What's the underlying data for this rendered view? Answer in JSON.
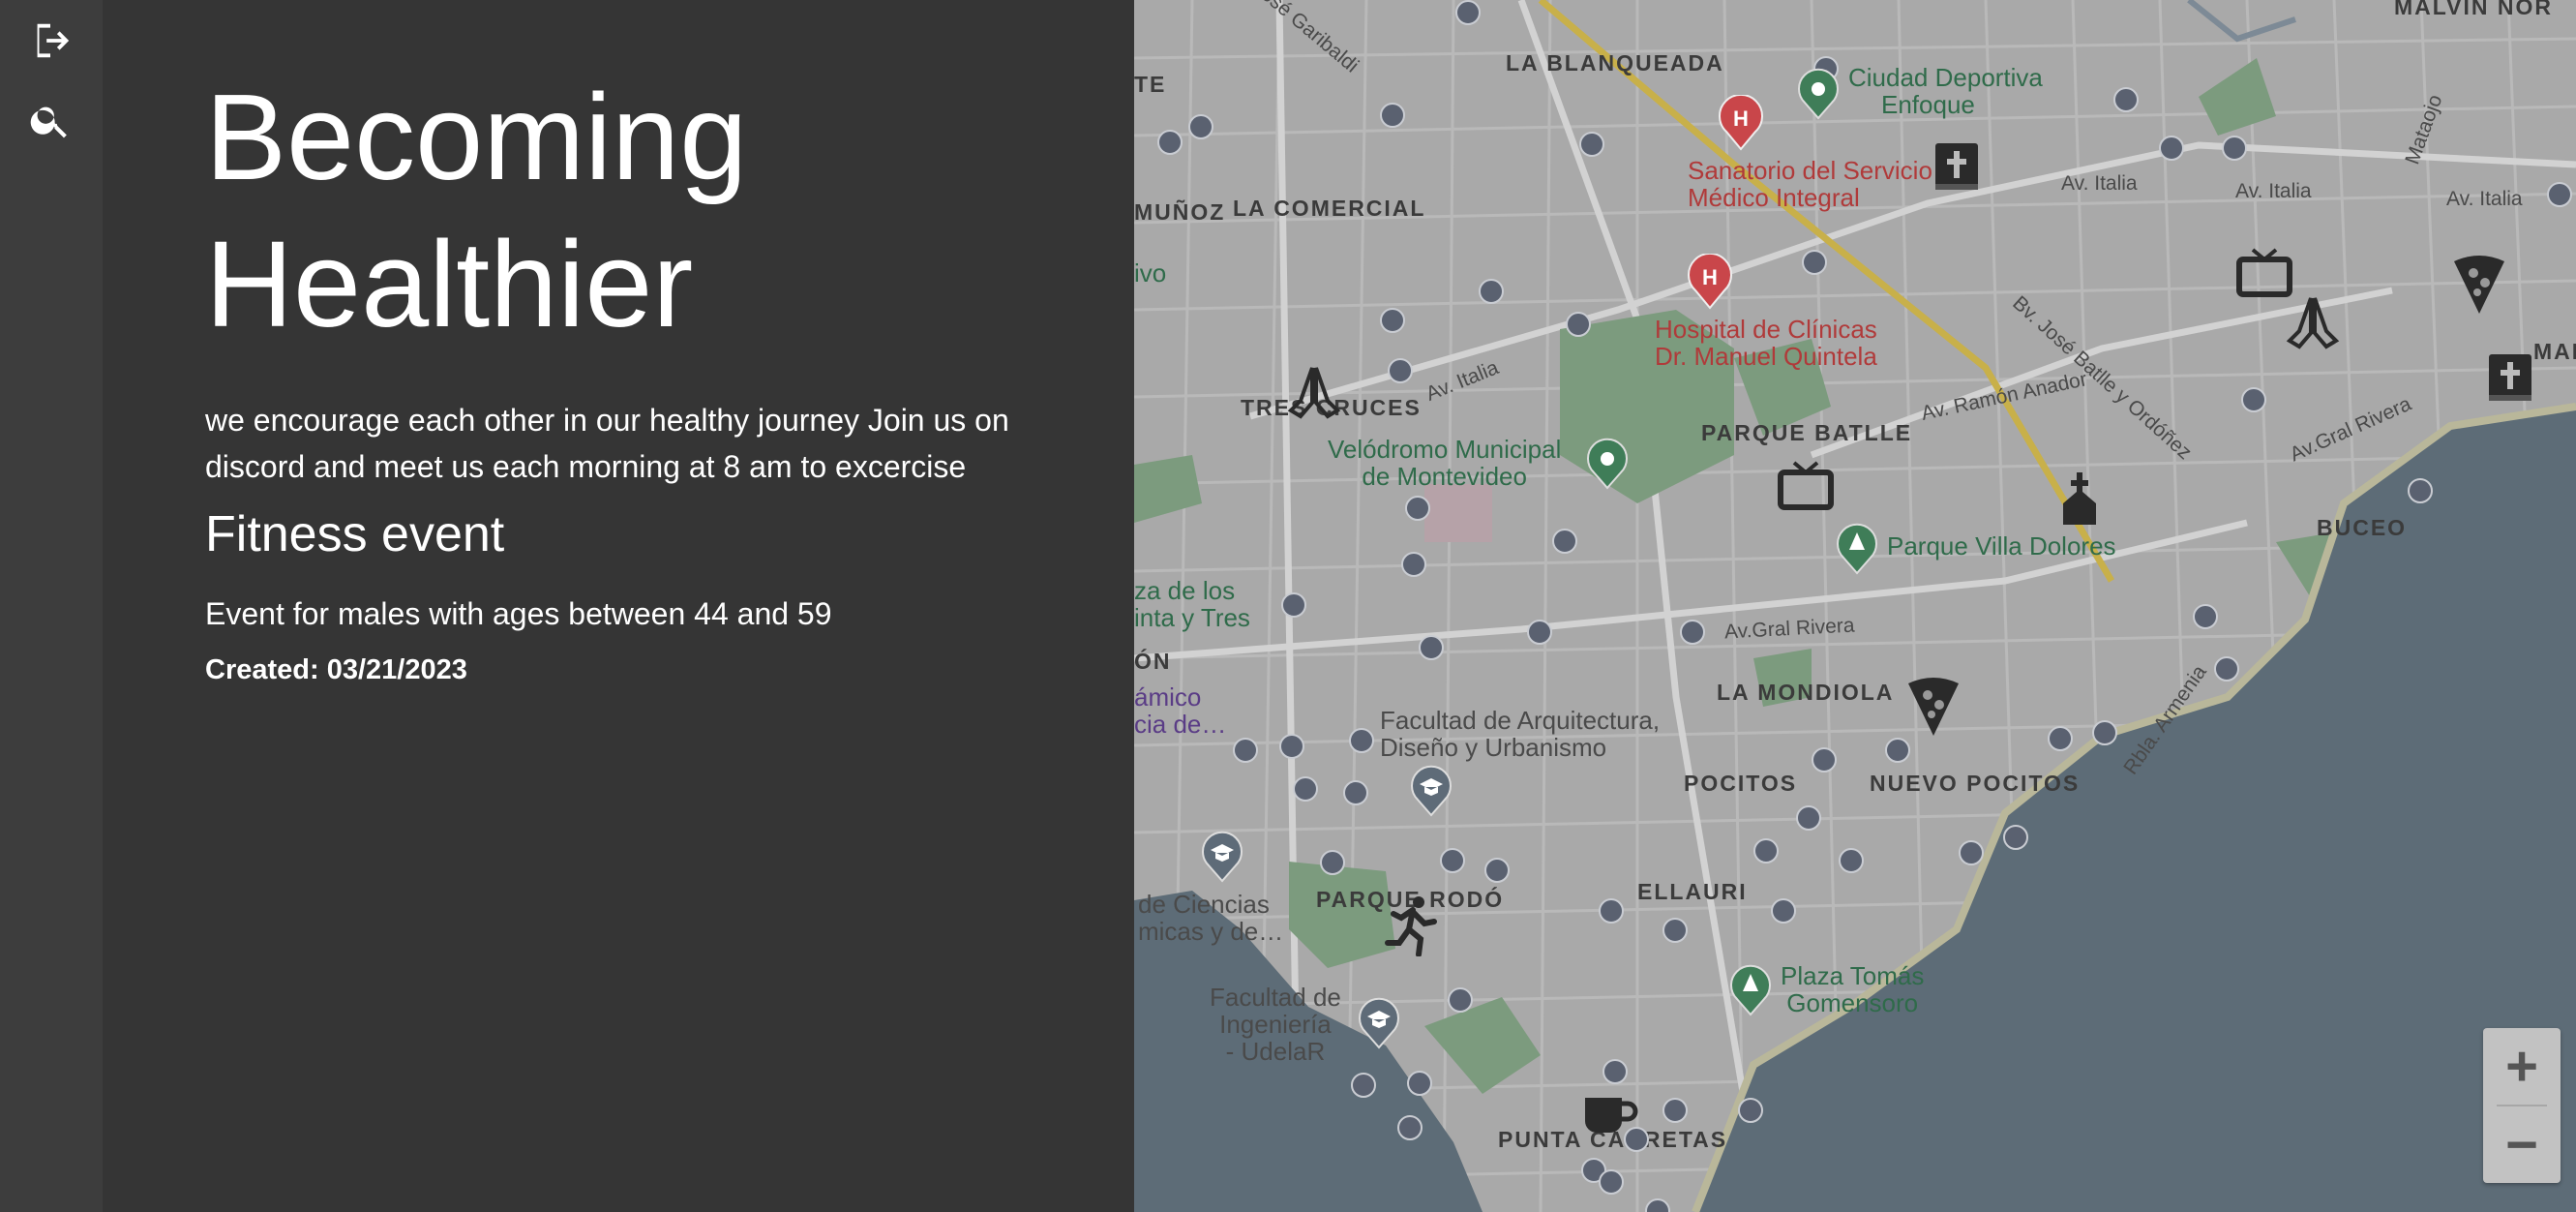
{
  "rail": {
    "logout_icon": "logout-icon",
    "search_icon": "search-icon"
  },
  "panel": {
    "title_line1": "Becoming",
    "title_line2": "Healthier",
    "description": "we encourage each other in our healthy journey Join us on discord and meet us each morning at 8 am to excercise",
    "event_title": "Fitness event",
    "event_description": "Event for males with ages between 44 and 59",
    "created": "Created: 03/21/2023"
  },
  "map": {
    "neighborhoods": {
      "la_blanqueada": "LA BLANQUEADA",
      "la_comercial": "LA COMERCIAL",
      "munoz": "MUÑOZ",
      "tres_cruces": "TRES CRUCES",
      "parque_batlle": "PARQUE BATLLE",
      "buceo": "BUCEO",
      "la_mondiola": "LA MONDIOLA",
      "pocitos": "POCITOS",
      "nuevo_pocitos": "NUEVO POCITOS",
      "parque_rodo": "PARQUE RODÓ",
      "ellauri": "ELLAURI",
      "punta_carretas": "PUNTA CARRETAS",
      "te": "TE",
      "on": "ÓN",
      "mal": "MAL",
      "malvin": "MALVIN NOR"
    },
    "pois": {
      "ciudad_deportiva_1": "Ciudad Deportiva",
      "ciudad_deportiva_2": "Enfoque",
      "sanatorio_1": "Sanatorio del Servicio",
      "sanatorio_2": "Médico Integral",
      "hospital_1": "Hospital de Clínicas",
      "hospital_2": "Dr. Manuel Quintela",
      "velodromo_1": "Velódromo Municipal",
      "velodromo_2": "de Montevideo",
      "villa_dolores": "Parque Villa Dolores",
      "arquitectura_1": "Facultad de Arquitectura,",
      "arquitectura_2": "Diseño y Urbanismo",
      "ciencias_1": "de Ciencias",
      "ciencias_2": "micas y de…",
      "ingenieria_1": "Facultad de",
      "ingenieria_2": "Ingeniería",
      "ingenieria_3": "- UdelaR",
      "plaza_tomas_1": "Plaza Tomás",
      "plaza_tomas_2": "Gomensoro",
      "plaza_los_1": "za de los",
      "plaza_los_2": "inta y Tres",
      "dinamico_1": "ámico",
      "dinamico_2": "cia de…",
      "ivo": "ivo"
    },
    "streets": {
      "av_italia_1": "Av. Italia",
      "av_italia_2": "Av. Italia",
      "av_italia_3": "Av. Italia",
      "av_italia_4": "Av. Italia",
      "batlle_ordonez": "Bv. José Batlle y Ordóñez",
      "ramon_anador": "Av. Ramón Anador",
      "gral_rivera_1": "Av.Gral Rivera",
      "gral_rivera_2": "Av.Gral Rivera",
      "garibaldi": "José Garibaldi",
      "armenia": "Rbla. Armenia",
      "mataojo": "Mataojo"
    },
    "zoom_in": "+",
    "zoom_out": "−"
  },
  "colors": {
    "panel_bg": "#353535",
    "rail_bg": "#3d3d3d",
    "map_land": "#a9a9a9",
    "map_water": "#5d6c77",
    "map_park": "#7c9b7e",
    "highway": "#c8b04a"
  }
}
